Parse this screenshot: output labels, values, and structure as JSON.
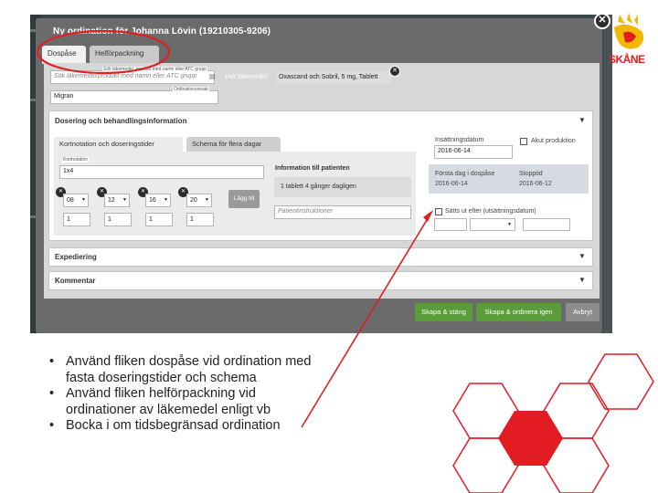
{
  "dialog": {
    "title": "Ny ordination för Johanna Lövin (19210305-9206)",
    "tabs": [
      {
        "label": "Dospåse",
        "active": true
      },
      {
        "label": "Helförpackning",
        "active": false
      }
    ]
  },
  "search": {
    "caption": "Sök läkemedel, produkt med namn eller ATC grupp",
    "placeholder": "Sök läkemedel/produkt med namn eller ATC grupp",
    "selected_label": "Valt läkemedel:",
    "selected_drug": "Oxascand och Sobril, 5 mg, Tablett"
  },
  "indication": {
    "caption": "Ordinationsorsak",
    "value": "Migran"
  },
  "sections": {
    "dosing": "Dosering och behandlingsinformation",
    "expedition": "Expediering",
    "comment": "Kommentar"
  },
  "dosing_tabs": [
    {
      "label": "Kortnotation och doseringstider",
      "active": true
    },
    {
      "label": "Schema för flera dagar",
      "active": false
    }
  ],
  "short_notation": {
    "caption": "Kortnotation",
    "value": "1x4"
  },
  "dose_times": [
    {
      "time": "08",
      "qty": "1"
    },
    {
      "time": "12",
      "qty": "1"
    },
    {
      "time": "16",
      "qty": "1"
    },
    {
      "time": "20",
      "qty": "1"
    }
  ],
  "add_time_label": "Lägg till",
  "patient_info": {
    "header": "Information till patienten",
    "text": "1 tablett 4 gånger dagligen",
    "instructions_placeholder": "Patientinstruktioner"
  },
  "dates": {
    "start_label": "Insättningsdatum",
    "start_value": "2016-06-14",
    "acute_label": "Akut produktion",
    "first_day_label": "Första dag i dospåse",
    "first_day_value": "2016-06-14",
    "stop_label": "Stopptid",
    "stop_value": "2016-06-12",
    "end_check_label": "Sätts ut efter (utsättningsdatum)"
  },
  "footer": {
    "create_close": "Skapa & stäng",
    "create_new": "Skapa & ordinera igen",
    "cancel": "Avbryt"
  },
  "bullets": [
    "Använd fliken dospåse vid ordination med fasta doseringstider och schema",
    "Använd fliken helförpackning vid ordinationer av läkemedel enligt vb",
    "Bocka i om tidsbegränsad ordination"
  ],
  "logo_text": "SKÅNE",
  "colors": {
    "annotation_red": "#e02020",
    "hex_red": "#e31b23",
    "logo_yellow": "#f2b800",
    "button_green": "#5a9c3a"
  }
}
